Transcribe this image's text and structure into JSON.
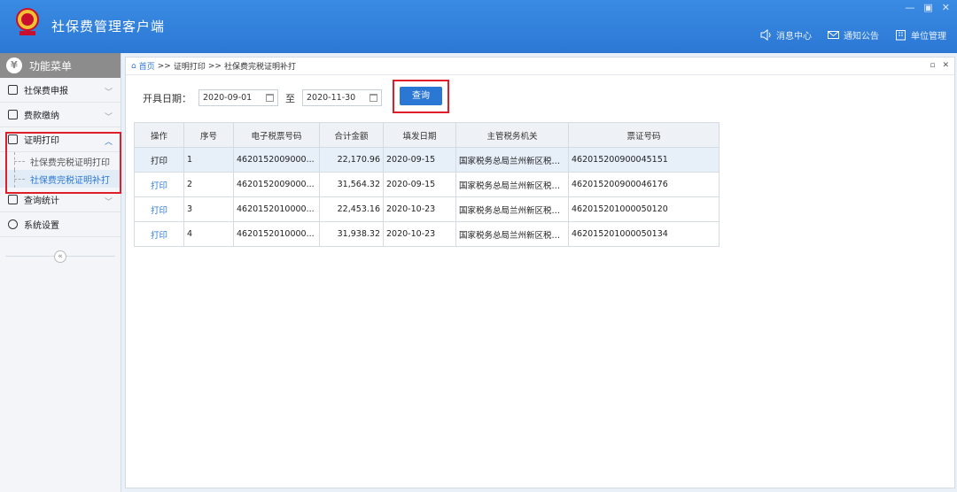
{
  "header": {
    "title": "社保费管理客户端",
    "window_controls": [
      "—",
      "▣",
      "✕"
    ],
    "actions": [
      {
        "label": "消息中心",
        "icon": "speaker-icon"
      },
      {
        "label": "通知公告",
        "icon": "mail-icon"
      },
      {
        "label": "单位管理",
        "icon": "building-icon"
      }
    ]
  },
  "sidebar": {
    "title": "功能菜单",
    "items": [
      {
        "label": "社保费申报"
      },
      {
        "label": "费款缴纳"
      },
      {
        "label": "证明打印"
      },
      {
        "label": "查询统计"
      },
      {
        "label": "系统设置"
      }
    ],
    "subitems": [
      {
        "label": "社保费完税证明打印"
      },
      {
        "label": "社保费完税证明补打"
      }
    ],
    "collapse_glyph": "«"
  },
  "breadcrumb": {
    "home": "首页",
    "sep": ">>",
    "level1": "证明打印",
    "level2": "社保费完税证明补打",
    "controls": [
      "▫",
      "✕"
    ]
  },
  "filter": {
    "label": "开具日期：",
    "start_date": "2020-09-01",
    "to_label": "至",
    "end_date": "2020-11-30",
    "query_button": "查询"
  },
  "table": {
    "headers": [
      "操作",
      "序号",
      "电子税票号码",
      "合计金额",
      "填发日期",
      "主管税务机关",
      "票证号码"
    ],
    "rows": [
      {
        "op": "打印",
        "seq": "1",
        "ticket": "4620152009000...",
        "amount": "22,170.96",
        "date": "2020-09-15",
        "office": "国家税务总局兰州新区税务...",
        "cert": "462015200900045151"
      },
      {
        "op": "打印",
        "seq": "2",
        "ticket": "4620152009000...",
        "amount": "31,564.32",
        "date": "2020-09-15",
        "office": "国家税务总局兰州新区税务...",
        "cert": "462015200900046176"
      },
      {
        "op": "打印",
        "seq": "3",
        "ticket": "4620152010000...",
        "amount": "22,453.16",
        "date": "2020-10-23",
        "office": "国家税务总局兰州新区税务...",
        "cert": "462015201000050120"
      },
      {
        "op": "打印",
        "seq": "4",
        "ticket": "4620152010000...",
        "amount": "31,938.32",
        "date": "2020-10-23",
        "office": "国家税务总局兰州新区税务...",
        "cert": "462015201000050134"
      }
    ]
  },
  "colors": {
    "header": "#2b78d4",
    "accent": "#2b78d4",
    "highlight": "#e01e2a"
  }
}
